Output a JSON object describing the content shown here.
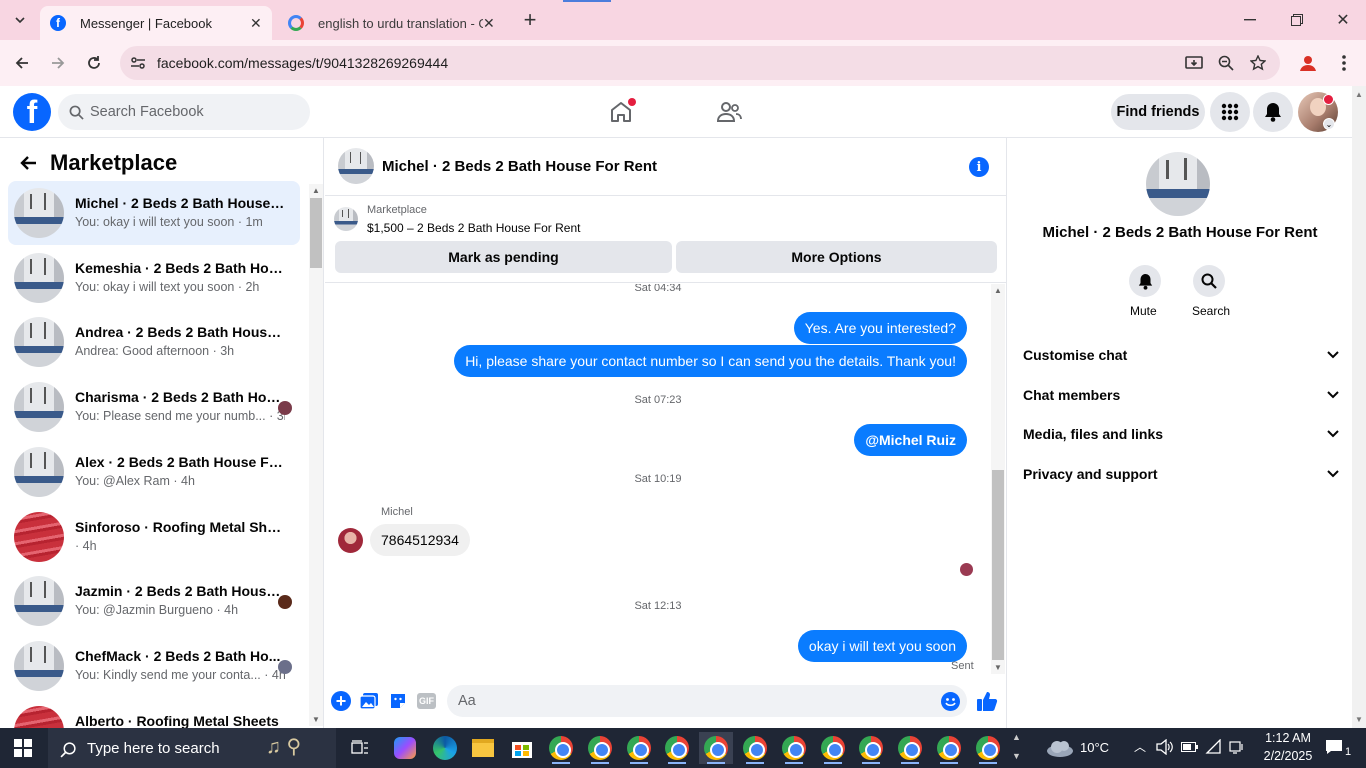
{
  "browser": {
    "tabs": [
      {
        "title": "Messenger | Facebook",
        "active": true
      },
      {
        "title": "english to urdu translation - Go",
        "active": false
      }
    ],
    "url": "facebook.com/messages/t/9041328269269444"
  },
  "fb_header": {
    "search_placeholder": "Search Facebook",
    "find_friends": "Find friends"
  },
  "sidebar": {
    "title": "Marketplace",
    "conversations": [
      {
        "name": "Michel · 2 Beds 2 Bath House F...",
        "preview": "You: okay i will text you soon · 1m",
        "selected": true,
        "thumb": "house"
      },
      {
        "name": "Kemeshia · 2 Beds 2 Bath House...",
        "preview": "You: okay i will text you soon · 2h",
        "thumb": "house"
      },
      {
        "name": "Andrea · 2 Beds 2 Bath House F...",
        "preview": "Andrea: Good afternoon · 3h",
        "thumb": "house"
      },
      {
        "name": "Charisma · 2 Beds 2 Bath Hou...",
        "preview": "You: Please send me your numb... · 3h",
        "thumb": "house",
        "read_color": "#7a3b4a"
      },
      {
        "name": "Alex · 2 Beds 2 Bath House For ...",
        "preview": "You: @Alex Ram · 4h",
        "thumb": "house"
      },
      {
        "name": "Sinforoso · Roofing Metal Sheets",
        "preview": "· 4h",
        "thumb": "roof"
      },
      {
        "name": "Jazmin · 2 Beds 2 Bath House...",
        "preview": "You: @Jazmin Burgueno · 4h",
        "thumb": "house",
        "read_color": "#5a2a1a"
      },
      {
        "name": "ChefMack · 2 Beds 2 Bath Ho...",
        "preview": "You: Kindly send me your conta... · 4h",
        "thumb": "house",
        "read_color": "#6b6f8a"
      },
      {
        "name": "Alberto · Roofing Metal Sheets",
        "preview": "",
        "thumb": "roof"
      }
    ]
  },
  "chat": {
    "title": "Michel · 2 Beds 2 Bath House For Rent",
    "listing_label": "Marketplace",
    "listing_price": "$1,500 – 2 Beds 2 Bath House For Rent",
    "mark_pending": "Mark as pending",
    "more_options": "More Options",
    "stamps": [
      "Sat 04:34",
      "Sat 07:23",
      "Sat 10:19",
      "Sat 12:13"
    ],
    "messages": {
      "m1": "Yes. Are you interested?",
      "m2": "Hi, please share your contact number so I can send you the details. Thank you!",
      "m3": "@Michel Ruiz",
      "sender": "Michel",
      "m4": "7864512934",
      "m5": "okay i will text you soon",
      "status": "Sent"
    },
    "input_placeholder": "Aa"
  },
  "info_panel": {
    "name": "Michel · 2 Beds 2 Bath House For Rent",
    "mute": "Mute",
    "search": "Search",
    "sections": [
      "Customise chat",
      "Chat members",
      "Media, files and links",
      "Privacy and support"
    ]
  },
  "taskbar": {
    "search_placeholder": "Type here to search",
    "weather": "10°C",
    "time": "1:12 AM",
    "date": "2/2/2025",
    "notifications": "1"
  },
  "colors": {
    "fb_blue": "#0866ff",
    "bubble_blue": "#0a7cff",
    "tab_pink": "#f8d6e2"
  }
}
